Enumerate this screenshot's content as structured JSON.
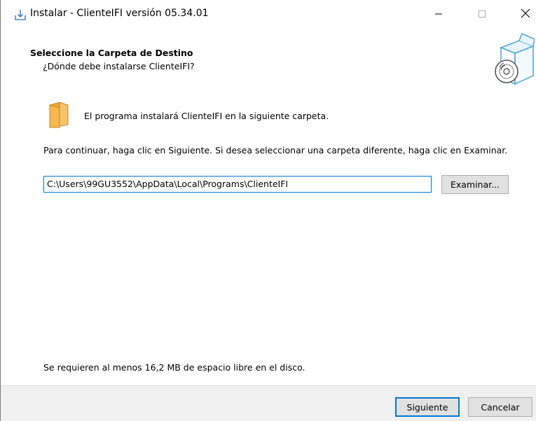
{
  "window": {
    "title": "Instalar - ClienteIFI versión 05.34.01",
    "minimize_icon": "minimize-icon",
    "maximize_icon": "maximize-icon",
    "close_icon": "close-icon",
    "app_icon": "install-download-icon"
  },
  "header": {
    "title": "Seleccione la Carpeta de Destino",
    "subtitle": "¿Dónde debe instalarse ClienteIFI?",
    "art_icon": "box-disc-icon"
  },
  "content": {
    "folder_icon": "folder-icon",
    "info": "El programa instalará ClienteIFI en la siguiente carpeta.",
    "instruction": "Para continuar, haga clic en Siguiente. Si desea seleccionar una carpeta diferente, haga clic en Examinar.",
    "path_value": "C:\\Users\\99GU3552\\AppData\\Local\\Programs\\ClienteIFI",
    "browse_label": "Examinar...",
    "space_required": "Se requieren al menos 16,2 MB de espacio libre en el disco."
  },
  "footer": {
    "next_label": "Siguiente",
    "cancel_label": "Cancelar"
  },
  "colors": {
    "accent": "#0078d7",
    "folder": "#f5b94e",
    "footer_bg": "#f0f0f0",
    "button_bg": "#e1e1e1"
  }
}
